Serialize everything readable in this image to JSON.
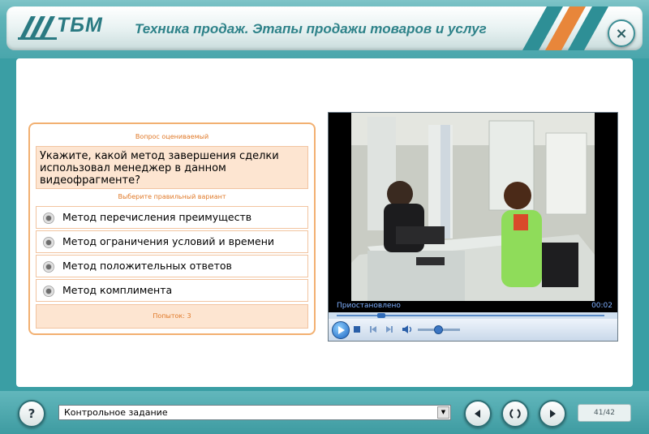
{
  "header": {
    "logo_text": "ТБМ",
    "title": "Техника продаж. Этапы продажи товаров и услуг",
    "close_label": "×"
  },
  "question": {
    "header": "Вопрос оцениваемый",
    "text": "Укажите, какой метод завершения сделки использовал менеджер в данном видеофрагменте?",
    "instruction": "Выберите правильный вариант",
    "options": [
      {
        "label": "Метод перечисления преимуществ"
      },
      {
        "label": "Метод ограничения условий и времени"
      },
      {
        "label": "Метод положительных ответов"
      },
      {
        "label": "Метод комплимента"
      }
    ],
    "attempts": "Попыток: 3"
  },
  "video": {
    "status": "Приостановлено",
    "time": "00:02"
  },
  "footer": {
    "help_label": "?",
    "section_select": "Контрольное задание",
    "page_counter": "41/42"
  },
  "colors": {
    "teal": "#3a9ea4",
    "accent_orange": "#e88a3a",
    "panel_border": "#f2b071",
    "panel_fill": "#fde5d1"
  }
}
